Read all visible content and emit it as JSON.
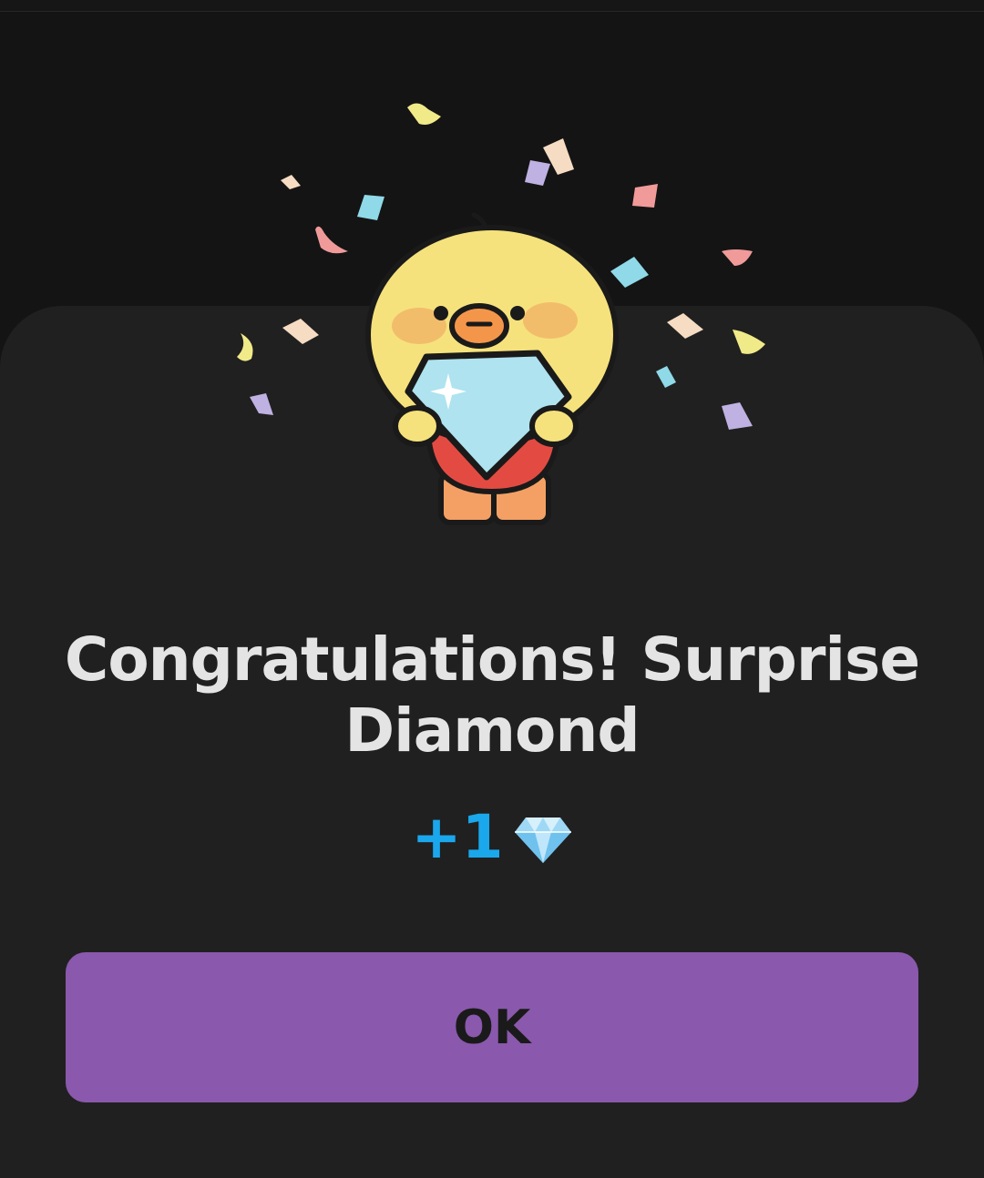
{
  "dialog": {
    "title": "Congratulations! Surprise Diamond",
    "reward_amount": "+1",
    "reward_icon": "diamond-icon",
    "ok_label": "OK"
  },
  "illustration": {
    "character": "duck-mascot-holding-diamond",
    "decoration": "confetti"
  },
  "colors": {
    "background": "#141414",
    "sheet": "#202020",
    "title_text": "#e4e4e4",
    "reward_text": "#1aa7ec",
    "button": "#8a58ac",
    "button_text": "#1a1a1a"
  }
}
